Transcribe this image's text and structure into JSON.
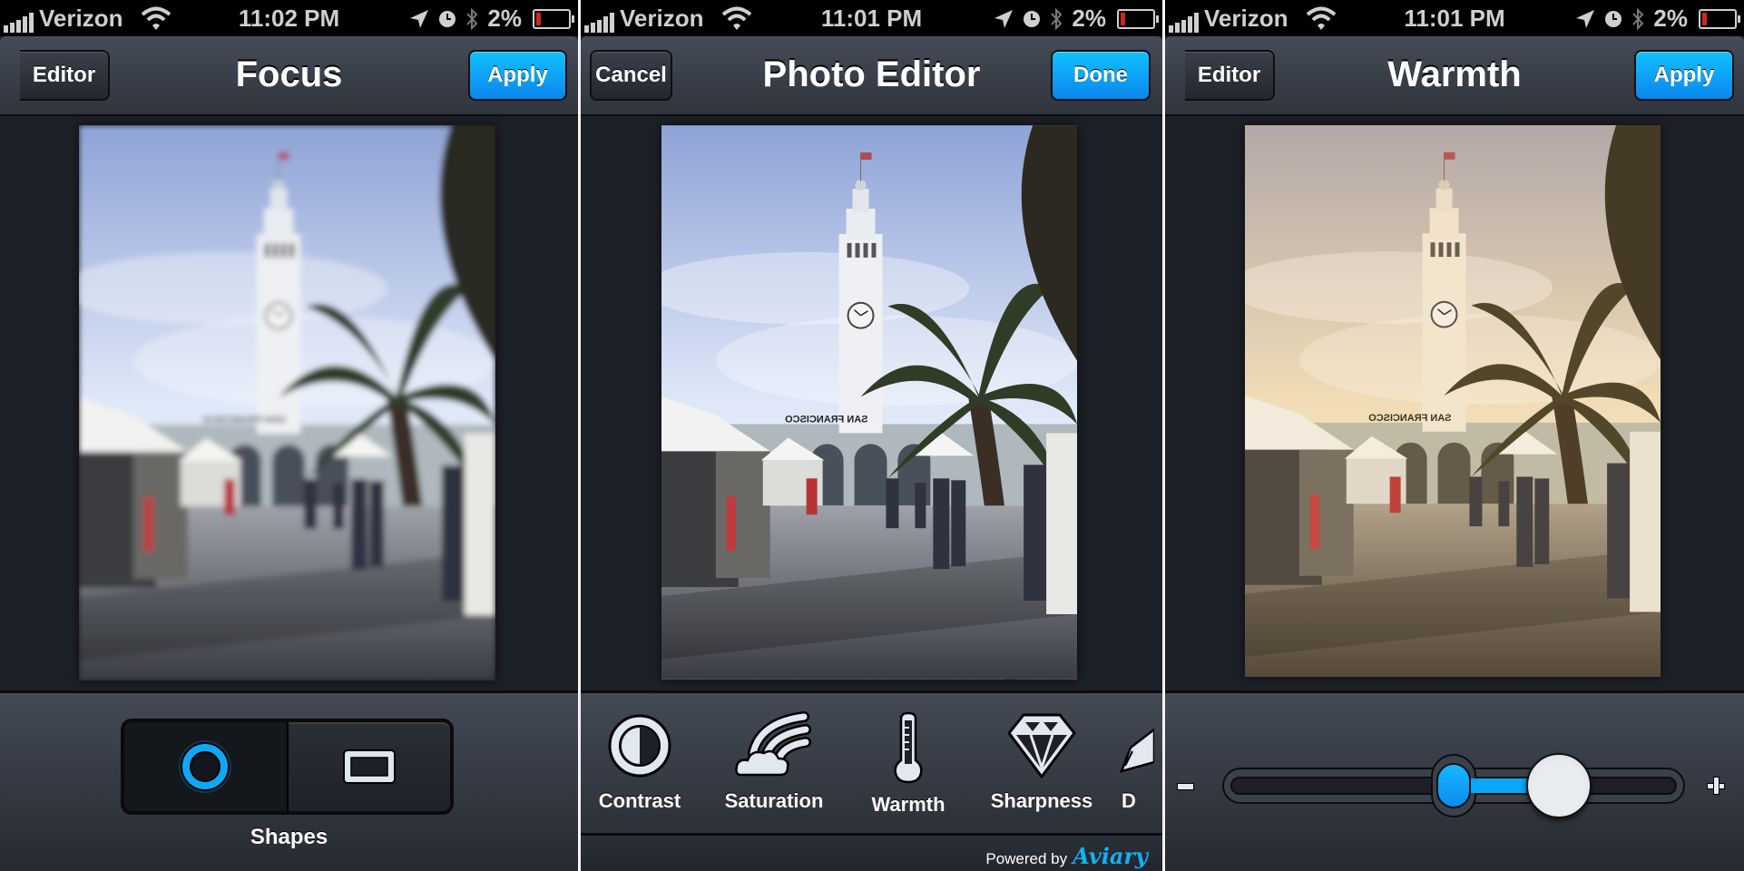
{
  "status_bars": [
    {
      "carrier": "Verizon",
      "time": "11:02 PM",
      "battery": "2%"
    },
    {
      "carrier": "Verizon",
      "time": "11:01 PM",
      "battery": "2%"
    },
    {
      "carrier": "Verizon",
      "time": "11:01 PM",
      "battery": "2%"
    }
  ],
  "status_icons": [
    "signal-bars-icon",
    "wifi-icon",
    "location-arrow-icon",
    "alarm-clock-icon",
    "bluetooth-icon",
    "battery-low-icon"
  ],
  "screens": [
    {
      "title": "Focus",
      "left_button": "Editor",
      "right_button": "Apply",
      "photo_effect": "blur",
      "shapes": {
        "label": "Shapes",
        "options": [
          {
            "name": "circle",
            "icon": "circle-shape-icon",
            "selected": true
          },
          {
            "name": "rectangle",
            "icon": "rectangle-shape-icon",
            "selected": false
          }
        ]
      }
    },
    {
      "title": "Photo Editor",
      "left_button": "Cancel",
      "right_button": "Done",
      "photo_effect": "none",
      "tools": [
        {
          "label": "Contrast",
          "icon": "contrast-icon"
        },
        {
          "label": "Saturation",
          "icon": "saturation-icon"
        },
        {
          "label": "Warmth",
          "icon": "thermometer-icon"
        },
        {
          "label": "Sharpness",
          "icon": "diamond-icon"
        },
        {
          "label": "D",
          "icon": "draw-pencil-icon"
        }
      ],
      "footer": {
        "powered_by": "Powered by",
        "brand": "Aviary"
      }
    },
    {
      "title": "Warmth",
      "left_button": "Editor",
      "right_button": "Apply",
      "photo_effect": "warm",
      "slider": {
        "min_label": "−",
        "max_label": "+",
        "min": -1,
        "max": 1,
        "value": 0.49
      }
    }
  ],
  "photo": {
    "sign_text": "SAN FRANCISCO"
  },
  "colors": {
    "accent_blue": "#0aa6f7",
    "nav_bg": "#3b414b",
    "battery_red": "#d4231f"
  }
}
